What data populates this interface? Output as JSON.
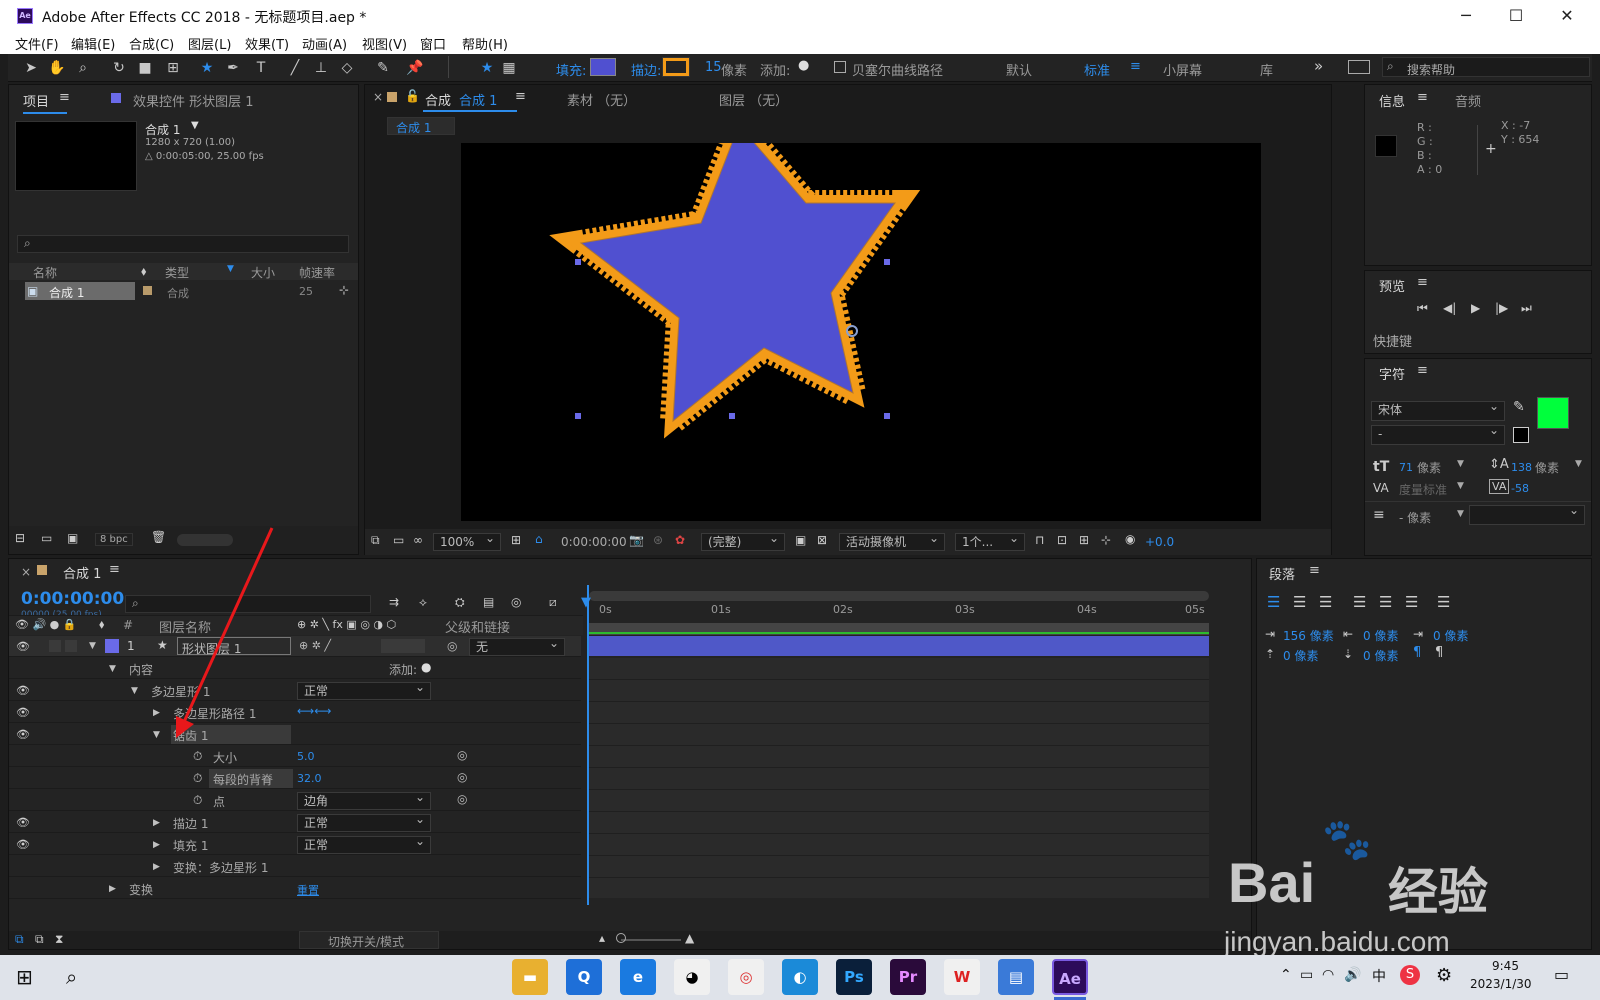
{
  "window": {
    "title": "Adobe After Effects CC 2018 - 无标题项目.aep *",
    "app_icon": "Ae",
    "minimize": "─",
    "maximize": "☐",
    "close": "✕"
  },
  "menu": [
    "文件(F)",
    "编辑(E)",
    "合成(C)",
    "图层(L)",
    "效果(T)",
    "动画(A)",
    "视图(V)",
    "窗口",
    "帮助(H)"
  ],
  "toolbar": {
    "fill_label": "填充:",
    "stroke_label": "描边:",
    "stroke_width": "15",
    "stroke_unit": "像素",
    "add_label": "添加:",
    "bezier_label": "贝塞尔曲线路径",
    "workspaces": [
      "默认",
      "标准",
      "小屏幕",
      "库"
    ],
    "active_workspace": "标准",
    "search_placeholder": "搜索帮助",
    "fill_color": "#5050d0",
    "stroke_color": "#f39b18"
  },
  "project": {
    "tab": "项目",
    "effects_tab": "效果控件 形状图层 1",
    "comp_name": "合成 1",
    "comp_res": "1280 x 720 (1.00)",
    "comp_dur": "△ 0:00:05:00, 25.00 fps",
    "columns": [
      "名称",
      "类型",
      "大小",
      "帧速率"
    ],
    "item": {
      "name": "合成 1",
      "type": "合成",
      "fps": "25"
    },
    "bpc": "8 bpc"
  },
  "viewer": {
    "tab_comp": "合成",
    "tab_comp_name": "合成 1",
    "tab_footage": "素材 （无）",
    "tab_layer": "图层 （无）",
    "crumb": "合成 1",
    "zoom": "100%",
    "timecode": "0:00:00:00",
    "quality": "(完整)",
    "camera": "活动摄像机",
    "views": "1个...",
    "exposure": "+0.0"
  },
  "info": {
    "tab": "信息",
    "audio_tab": "音频",
    "r": "R :",
    "g": "G :",
    "b": "B :",
    "a": "A : 0",
    "x": "X : -7",
    "y": "Y : 654"
  },
  "preview": {
    "tab": "预览",
    "shortcut": "快捷键"
  },
  "character": {
    "tab": "字符",
    "font": "宋体",
    "style": "-",
    "size": "71",
    "size_unit": "像素",
    "leading": "138",
    "leading_unit": "像素",
    "kerning": "度量标准",
    "tracking": "-58",
    "indent": "- 像素",
    "fill_color": "#00ff3c"
  },
  "paragraph": {
    "tab": "段落",
    "v1": "156 像素",
    "v2": "0 像素",
    "v3": "0 像素",
    "v4": "0 像素",
    "v5": "0 像素"
  },
  "timeline": {
    "tab": "合成 1",
    "timecode": "0:00:00:00",
    "frames": "00000 (25.00 fps)",
    "col_layer_name": "图层名称",
    "col_parent": "父级和链接",
    "ticks": [
      "0s",
      "01s",
      "02s",
      "03s",
      "04s",
      "05s"
    ],
    "footer": "切换开关/模式",
    "layer": {
      "num": "1",
      "name": "形状图层 1",
      "parent": "无"
    },
    "rows": {
      "contents": "内容",
      "add": "添加:",
      "polystar": "多边星形 1",
      "polystar_mode": "正常",
      "polystar_path": "多边星形路径 1",
      "zigzag": "锯齿 1",
      "size_lbl": "大小",
      "size_val": "5.0",
      "ridges_lbl": "每段的背脊",
      "ridges_val": "32.0",
      "points_lbl": "点",
      "points_val": "边角",
      "stroke": "描边 1",
      "stroke_mode": "正常",
      "fill": "填充 1",
      "fill_mode": "正常",
      "xform_poly": "变换：多边星形 1",
      "xform": "变换",
      "reset": "重置"
    }
  },
  "taskbar": {
    "time": "9:45",
    "date": "2023/1/30",
    "ime": "中"
  },
  "watermark": {
    "line1": "Bai",
    "line2": "经验",
    "url": "jingyan.baidu.com"
  }
}
